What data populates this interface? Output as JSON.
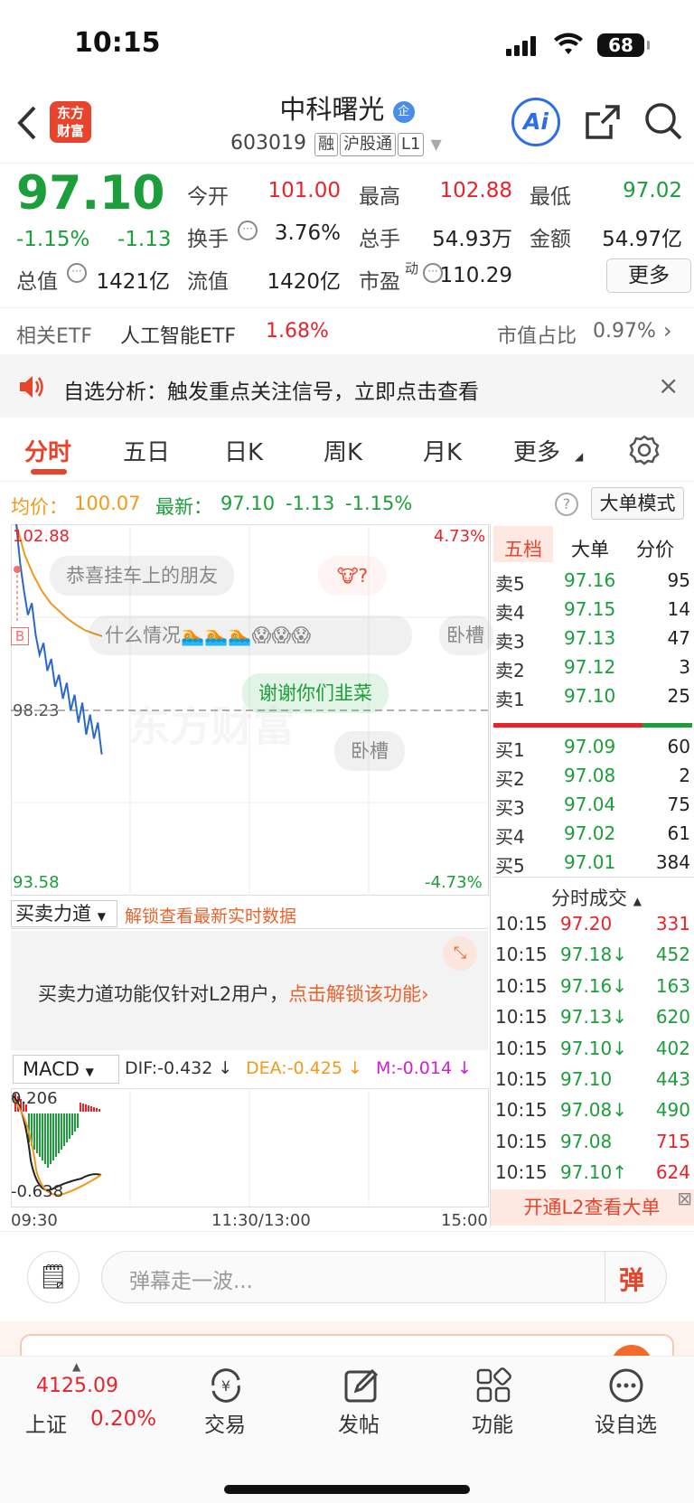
{
  "status": {
    "time": "10:15",
    "battery": "68"
  },
  "header": {
    "logo_line1": "东方",
    "logo_line2": "财富",
    "name": "中科曙光",
    "badge": "企",
    "code": "603019",
    "tags": [
      "融",
      "沪股通",
      "L1"
    ],
    "ai": "Ai"
  },
  "quote": {
    "price": "97.10",
    "pct": "-1.15%",
    "chg": "-1.13",
    "open_l": "今开",
    "open": "101.00",
    "high_l": "最高",
    "high": "102.88",
    "low_l": "最低",
    "low": "97.02",
    "turnover_l": "换手",
    "turnover": "3.76%",
    "vol_l": "总手",
    "vol": "54.93万",
    "amt_l": "金额",
    "amt": "54.97亿",
    "mcap_l": "总值",
    "mcap": "1421亿",
    "float_l": "流值",
    "float": "1420亿",
    "pe_l": "市盈",
    "pe_sup": "动",
    "pe": "110.29",
    "more": "更多"
  },
  "etf": {
    "label": "相关ETF",
    "name": "人工智能ETF",
    "pct": "1.68%",
    "ratio_l": "市值占比",
    "ratio": "0.97%"
  },
  "notice": "自选分析：触发重点关注信号，立即点击查看",
  "tabs": [
    "分时",
    "五日",
    "日K",
    "周K",
    "月K",
    "更多"
  ],
  "info": {
    "avg_l": "均价：",
    "avg": "100.07",
    "last_l": "最新：",
    "last": "97.10",
    "chg": "-1.13",
    "pct": "-1.15%",
    "mode": "大单模式"
  },
  "chart": {
    "ymax": "102.88",
    "ymid": "98.23",
    "ymin": "93.58",
    "pmax": "4.73%",
    "pmin": "-4.73%",
    "marker": "B",
    "t0": "09:30",
    "t1": "11:30/13:00",
    "t2": "15:00",
    "watermark": "东方财富",
    "bubbles": [
      "恭喜挂车上的朋友",
      "什么情况",
      "谢谢你们韭菜",
      "卧槽",
      "卧槽"
    ],
    "emoji": "🏊🏊🏊😱😱😱"
  },
  "chart_data": {
    "type": "line",
    "title": "",
    "series": [
      {
        "name": "",
        "values": [
          102.88,
          101.9,
          101.2,
          100.6,
          100.9,
          100.1,
          99.6,
          99.9,
          99.2,
          99.5,
          98.8,
          99.1,
          98.5,
          98.9,
          98.2,
          98.6,
          97.9,
          98.4,
          97.6,
          98.1,
          97.5,
          97.9,
          97.1
        ]
      },
      {
        "name": "",
        "values": [
          102.88,
          102.1,
          101.6,
          101.2,
          100.9,
          100.7,
          100.5,
          100.35,
          100.22,
          100.14,
          100.07
        ]
      }
    ],
    "ylim": [
      93.58,
      102.88
    ]
  },
  "power": {
    "label": "买卖力道",
    "unlock": "解锁查看最新实时数据",
    "msg": "买卖力道功能仅针对L2用户，",
    "link": "点击解锁该功能"
  },
  "macd": {
    "label": "MACD",
    "dif": "DIF:-0.432 ↓",
    "dea": "DEA:-0.425 ↓",
    "m": "M:-0.014 ↓",
    "top": "0.206",
    "bot": "-0.638"
  },
  "book": {
    "tabs": [
      "五档",
      "大单",
      "分价"
    ],
    "asks": [
      [
        "卖5",
        "97.16",
        "95"
      ],
      [
        "卖4",
        "97.15",
        "14"
      ],
      [
        "卖3",
        "97.13",
        "47"
      ],
      [
        "卖2",
        "97.12",
        "3"
      ],
      [
        "卖1",
        "97.10",
        "25"
      ]
    ],
    "bids": [
      [
        "买1",
        "97.09",
        "60"
      ],
      [
        "买2",
        "97.08",
        "2"
      ],
      [
        "买3",
        "97.04",
        "75"
      ],
      [
        "买4",
        "97.02",
        "61"
      ],
      [
        "买5",
        "97.01",
        "384"
      ]
    ],
    "ticks_label": "分时成交",
    "ticks": [
      [
        "10:15",
        "97.20",
        "331"
      ],
      [
        "10:15",
        "97.18↓",
        "452"
      ],
      [
        "10:15",
        "97.16↓",
        "163"
      ],
      [
        "10:15",
        "97.13↓",
        "620"
      ],
      [
        "10:15",
        "97.10↓",
        "402"
      ],
      [
        "10:15",
        "97.10",
        "443"
      ],
      [
        "10:15",
        "97.08↓",
        "490"
      ],
      [
        "10:15",
        "97.08",
        "715"
      ],
      [
        "10:15",
        "97.10↑",
        "624"
      ]
    ],
    "l2": "开通L2查看大单"
  },
  "comment": {
    "placeholder": "弹幕走一波...",
    "send": "弹"
  },
  "nav": {
    "index": "4125.09",
    "index_name": "上证",
    "index_pct": "0.20%",
    "items": [
      "交易",
      "发帖",
      "功能",
      "设自选"
    ]
  }
}
